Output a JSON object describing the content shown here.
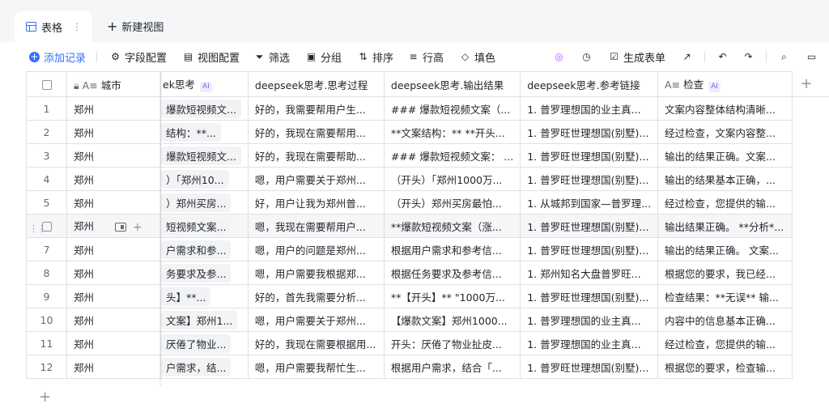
{
  "tabs": {
    "active_label": "表格",
    "more": "⋮",
    "new_view_label": "新建视图"
  },
  "toolbar": {
    "add_record": "添加记录",
    "field_config": "字段配置",
    "view_config": "视图配置",
    "filter": "筛选",
    "group": "分组",
    "sort": "排序",
    "row_height": "行高",
    "fill": "填色",
    "generate_form": "生成表单"
  },
  "columns": {
    "city": "城市",
    "think": "ek思考",
    "think_process": "deepseek思考.思考过程",
    "think_result": "deepseek思考.输出结果",
    "think_links": "deepseek思考.参考链接",
    "check": "检查",
    "ai_badge": "AI"
  },
  "rows": [
    {
      "num": "1",
      "city": "郑州",
      "tag": "爆款短视频文...",
      "process": "好的，我需要帮用户生...",
      "result": "### 爆款短视频文案（...",
      "links": "1. 普罗理想国的业主真...",
      "check": "文案内容整体结构清晰..."
    },
    {
      "num": "2",
      "city": "郑州",
      "tag": "结构：**...",
      "process": "好的，我现在需要帮用...",
      "result": "**文案结构：** **开头...",
      "links": "1. 普罗旺世理想国(别墅)...",
      "check": "经过检查，文案内容整..."
    },
    {
      "num": "3",
      "city": "郑州",
      "tag": "爆款短视频文...",
      "process": "好的，我现在需要帮助...",
      "result": "### 爆款短视频文案： ...",
      "links": "1. 普罗旺世理想国(别墅)...",
      "check": "输出的结果正确。文案..."
    },
    {
      "num": "4",
      "city": "郑州",
      "tag": "）「郑州10...",
      "process": "嗯，用户需要关于郑州...",
      "result": "（开头）「郑州1000万...",
      "links": "1. 普罗旺世理想国(别墅)...",
      "check": "输出的结果基本正确，..."
    },
    {
      "num": "5",
      "city": "郑州",
      "tag": "）郑州买房...",
      "process": "好，用户让我为郑州普...",
      "result": "（开头）郑州买房最怕...",
      "links": "1. 从城邦到国家—普罗理...",
      "check": "经过检查，您提供的输..."
    },
    {
      "num": "",
      "city": "郑州",
      "tag": "短视频文案...",
      "process": "嗯，我现在需要帮用户...",
      "result": "**爆款短视频文案（涨...",
      "links": "1. 普罗旺世理想国(别墅)...",
      "check": "输出结果正确。 **分析*..."
    },
    {
      "num": "7",
      "city": "郑州",
      "tag": "户需求和参...",
      "process": "嗯，用户的问题是郑州...",
      "result": "根据用户需求和参考信...",
      "links": "1. 普罗旺世理想国(别墅)...",
      "check": "输出的结果正确。 文案..."
    },
    {
      "num": "8",
      "city": "郑州",
      "tag": "务要求及参...",
      "process": "嗯，用户需要我根据郑...",
      "result": "根据任务要求及参考信...",
      "links": "1. 郑州知名大盘普罗旺...",
      "check": "根据您的要求，我已经..."
    },
    {
      "num": "9",
      "city": "郑州",
      "tag": "头】**...",
      "process": "好的，首先我需要分析...",
      "result": "**【开头】** \"1000万...",
      "links": "1. 普罗旺世理想国(别墅)...",
      "check": "检查结果：**无误** 输..."
    },
    {
      "num": "10",
      "city": "郑州",
      "tag": "文案】郑州1...",
      "process": "嗯，用户需要关于郑州...",
      "result": "【爆款文案】郑州1000...",
      "links": "1. 普罗理想国的业主真...",
      "check": "内容中的信息基本正确..."
    },
    {
      "num": "11",
      "city": "郑州",
      "tag": "厌倦了物业...",
      "process": "好的，我现在需要根据用...",
      "result": "开头：厌倦了物业扯皮...",
      "links": "1. 普罗理想国的业主真...",
      "check": "经过检查，您提供的输..."
    },
    {
      "num": "12",
      "city": "郑州",
      "tag": "户需求，结...",
      "process": "嗯，用户需要我帮忙生...",
      "result": "根据用户需求，结合「...",
      "links": "1. 普罗旺世理想国(别墅)...",
      "check": "根据您的要求，检查输..."
    }
  ]
}
